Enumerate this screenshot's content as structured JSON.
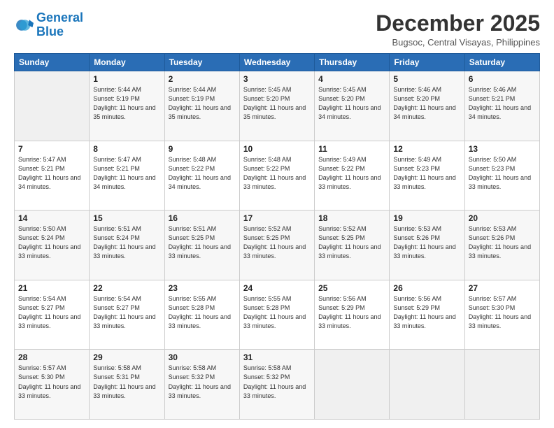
{
  "header": {
    "logo_general": "General",
    "logo_blue": "Blue",
    "month_title": "December 2025",
    "location": "Bugsoc, Central Visayas, Philippines"
  },
  "weekdays": [
    "Sunday",
    "Monday",
    "Tuesday",
    "Wednesday",
    "Thursday",
    "Friday",
    "Saturday"
  ],
  "weeks": [
    [
      {
        "day": "",
        "sunrise": "",
        "sunset": "",
        "daylight": ""
      },
      {
        "day": "1",
        "sunrise": "Sunrise: 5:44 AM",
        "sunset": "Sunset: 5:19 PM",
        "daylight": "Daylight: 11 hours and 35 minutes."
      },
      {
        "day": "2",
        "sunrise": "Sunrise: 5:44 AM",
        "sunset": "Sunset: 5:19 PM",
        "daylight": "Daylight: 11 hours and 35 minutes."
      },
      {
        "day": "3",
        "sunrise": "Sunrise: 5:45 AM",
        "sunset": "Sunset: 5:20 PM",
        "daylight": "Daylight: 11 hours and 35 minutes."
      },
      {
        "day": "4",
        "sunrise": "Sunrise: 5:45 AM",
        "sunset": "Sunset: 5:20 PM",
        "daylight": "Daylight: 11 hours and 34 minutes."
      },
      {
        "day": "5",
        "sunrise": "Sunrise: 5:46 AM",
        "sunset": "Sunset: 5:20 PM",
        "daylight": "Daylight: 11 hours and 34 minutes."
      },
      {
        "day": "6",
        "sunrise": "Sunrise: 5:46 AM",
        "sunset": "Sunset: 5:21 PM",
        "daylight": "Daylight: 11 hours and 34 minutes."
      }
    ],
    [
      {
        "day": "7",
        "sunrise": "Sunrise: 5:47 AM",
        "sunset": "Sunset: 5:21 PM",
        "daylight": "Daylight: 11 hours and 34 minutes."
      },
      {
        "day": "8",
        "sunrise": "Sunrise: 5:47 AM",
        "sunset": "Sunset: 5:21 PM",
        "daylight": "Daylight: 11 hours and 34 minutes."
      },
      {
        "day": "9",
        "sunrise": "Sunrise: 5:48 AM",
        "sunset": "Sunset: 5:22 PM",
        "daylight": "Daylight: 11 hours and 34 minutes."
      },
      {
        "day": "10",
        "sunrise": "Sunrise: 5:48 AM",
        "sunset": "Sunset: 5:22 PM",
        "daylight": "Daylight: 11 hours and 33 minutes."
      },
      {
        "day": "11",
        "sunrise": "Sunrise: 5:49 AM",
        "sunset": "Sunset: 5:22 PM",
        "daylight": "Daylight: 11 hours and 33 minutes."
      },
      {
        "day": "12",
        "sunrise": "Sunrise: 5:49 AM",
        "sunset": "Sunset: 5:23 PM",
        "daylight": "Daylight: 11 hours and 33 minutes."
      },
      {
        "day": "13",
        "sunrise": "Sunrise: 5:50 AM",
        "sunset": "Sunset: 5:23 PM",
        "daylight": "Daylight: 11 hours and 33 minutes."
      }
    ],
    [
      {
        "day": "14",
        "sunrise": "Sunrise: 5:50 AM",
        "sunset": "Sunset: 5:24 PM",
        "daylight": "Daylight: 11 hours and 33 minutes."
      },
      {
        "day": "15",
        "sunrise": "Sunrise: 5:51 AM",
        "sunset": "Sunset: 5:24 PM",
        "daylight": "Daylight: 11 hours and 33 minutes."
      },
      {
        "day": "16",
        "sunrise": "Sunrise: 5:51 AM",
        "sunset": "Sunset: 5:25 PM",
        "daylight": "Daylight: 11 hours and 33 minutes."
      },
      {
        "day": "17",
        "sunrise": "Sunrise: 5:52 AM",
        "sunset": "Sunset: 5:25 PM",
        "daylight": "Daylight: 11 hours and 33 minutes."
      },
      {
        "day": "18",
        "sunrise": "Sunrise: 5:52 AM",
        "sunset": "Sunset: 5:25 PM",
        "daylight": "Daylight: 11 hours and 33 minutes."
      },
      {
        "day": "19",
        "sunrise": "Sunrise: 5:53 AM",
        "sunset": "Sunset: 5:26 PM",
        "daylight": "Daylight: 11 hours and 33 minutes."
      },
      {
        "day": "20",
        "sunrise": "Sunrise: 5:53 AM",
        "sunset": "Sunset: 5:26 PM",
        "daylight": "Daylight: 11 hours and 33 minutes."
      }
    ],
    [
      {
        "day": "21",
        "sunrise": "Sunrise: 5:54 AM",
        "sunset": "Sunset: 5:27 PM",
        "daylight": "Daylight: 11 hours and 33 minutes."
      },
      {
        "day": "22",
        "sunrise": "Sunrise: 5:54 AM",
        "sunset": "Sunset: 5:27 PM",
        "daylight": "Daylight: 11 hours and 33 minutes."
      },
      {
        "day": "23",
        "sunrise": "Sunrise: 5:55 AM",
        "sunset": "Sunset: 5:28 PM",
        "daylight": "Daylight: 11 hours and 33 minutes."
      },
      {
        "day": "24",
        "sunrise": "Sunrise: 5:55 AM",
        "sunset": "Sunset: 5:28 PM",
        "daylight": "Daylight: 11 hours and 33 minutes."
      },
      {
        "day": "25",
        "sunrise": "Sunrise: 5:56 AM",
        "sunset": "Sunset: 5:29 PM",
        "daylight": "Daylight: 11 hours and 33 minutes."
      },
      {
        "day": "26",
        "sunrise": "Sunrise: 5:56 AM",
        "sunset": "Sunset: 5:29 PM",
        "daylight": "Daylight: 11 hours and 33 minutes."
      },
      {
        "day": "27",
        "sunrise": "Sunrise: 5:57 AM",
        "sunset": "Sunset: 5:30 PM",
        "daylight": "Daylight: 11 hours and 33 minutes."
      }
    ],
    [
      {
        "day": "28",
        "sunrise": "Sunrise: 5:57 AM",
        "sunset": "Sunset: 5:30 PM",
        "daylight": "Daylight: 11 hours and 33 minutes."
      },
      {
        "day": "29",
        "sunrise": "Sunrise: 5:58 AM",
        "sunset": "Sunset: 5:31 PM",
        "daylight": "Daylight: 11 hours and 33 minutes."
      },
      {
        "day": "30",
        "sunrise": "Sunrise: 5:58 AM",
        "sunset": "Sunset: 5:32 PM",
        "daylight": "Daylight: 11 hours and 33 minutes."
      },
      {
        "day": "31",
        "sunrise": "Sunrise: 5:58 AM",
        "sunset": "Sunset: 5:32 PM",
        "daylight": "Daylight: 11 hours and 33 minutes."
      },
      {
        "day": "",
        "sunrise": "",
        "sunset": "",
        "daylight": ""
      },
      {
        "day": "",
        "sunrise": "",
        "sunset": "",
        "daylight": ""
      },
      {
        "day": "",
        "sunrise": "",
        "sunset": "",
        "daylight": ""
      }
    ]
  ]
}
